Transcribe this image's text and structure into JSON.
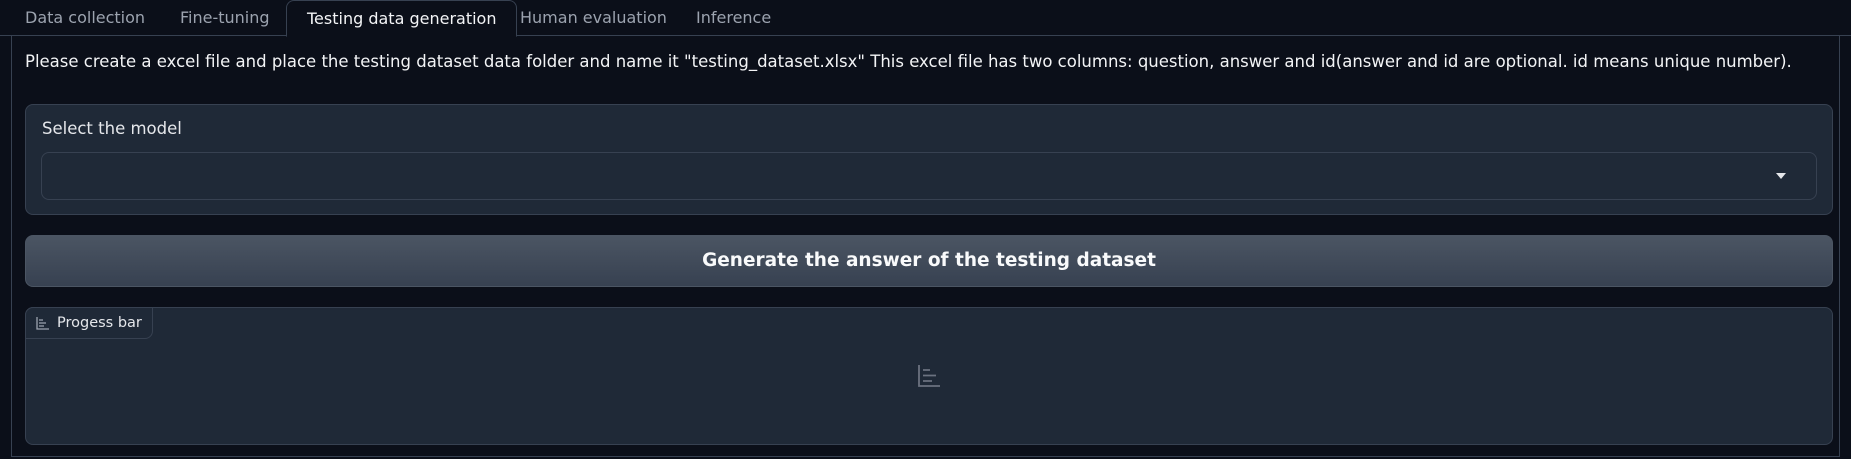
{
  "tabs": [
    {
      "label": "Data collection",
      "active": false
    },
    {
      "label": "Fine-tuning",
      "active": false
    },
    {
      "label": "Testing data generation",
      "active": true
    },
    {
      "label": "Human evaluation",
      "active": false
    },
    {
      "label": "Inference",
      "active": false
    }
  ],
  "instructions": "Please create a excel file and place the testing dataset data folder and name it \"testing_dataset.xlsx\" This excel file has two columns: question, answer and id(answer and id are optional. id means unique number).",
  "model_select": {
    "label": "Select the model",
    "value": "",
    "icon": "chevron-down-icon"
  },
  "generate_button": {
    "label": "Generate the answer of the testing dataset"
  },
  "progress": {
    "label": "Progess bar",
    "icon": "bar-chart-icon"
  },
  "colors": {
    "background": "#0b0f19",
    "block": "#1f2937",
    "border": "#374151",
    "button": "#4b5563"
  }
}
